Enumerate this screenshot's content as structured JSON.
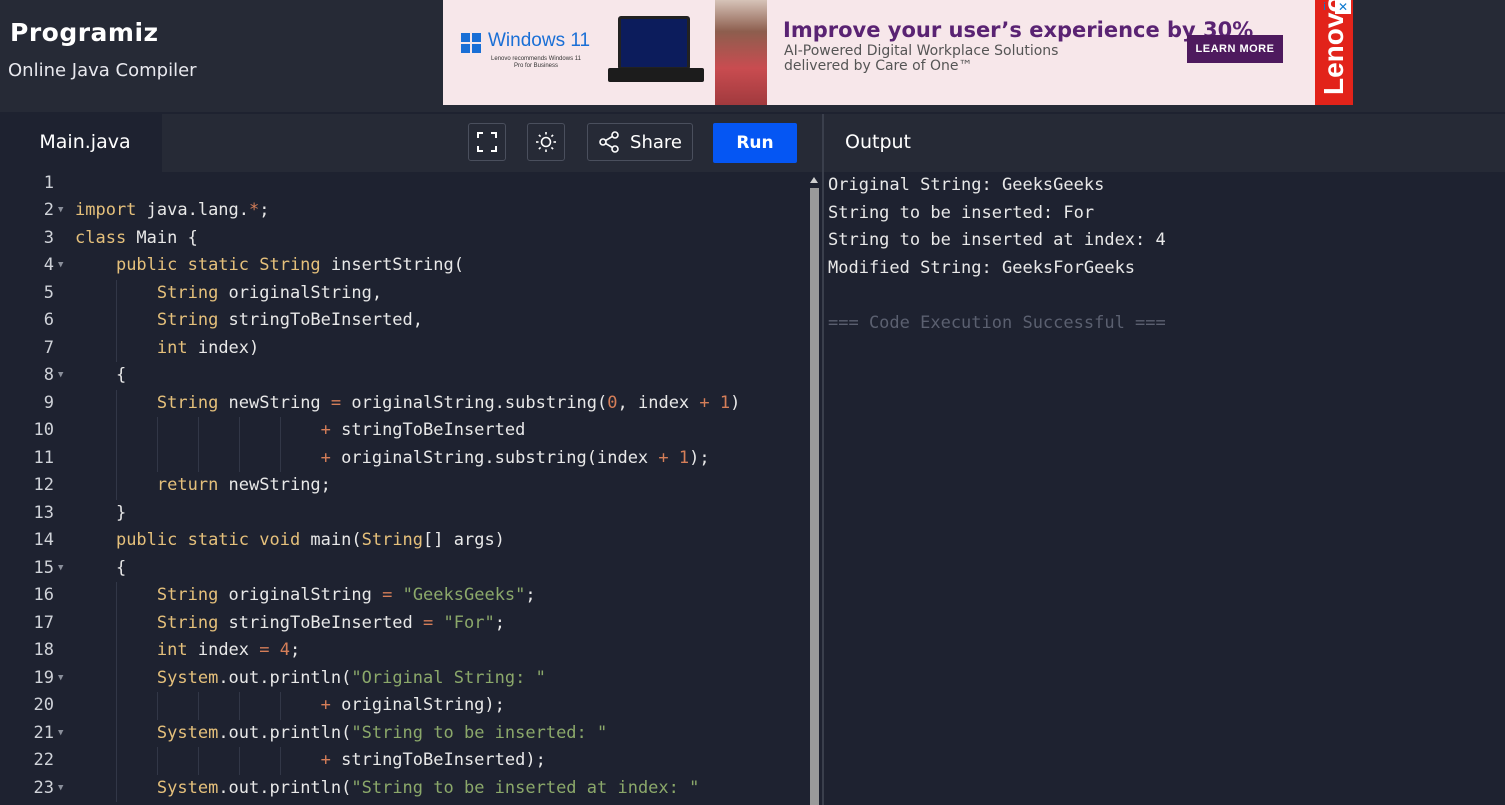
{
  "brand": {
    "logo": "Programiz",
    "subtitle": "Online Java Compiler"
  },
  "ad": {
    "windows_title": "Windows 11",
    "windows_sub": "Lenovo recommends Windows 11 Pro for Business",
    "headline": "Improve your user’s experience by 30%",
    "body_line1": "AI-Powered Digital Workplace Solutions",
    "body_line2": "delivered by Care of One™",
    "cta": "LEARN MORE",
    "brand": "Lenovo",
    "info": "i",
    "close": "✕",
    "brand_color": "#e2231a",
    "cta_color": "#4e1a5e"
  },
  "editor": {
    "tab": "Main.java",
    "share_label": "Share",
    "run_label": "Run",
    "run_color": "#0556f3",
    "line_numbers": [
      "1",
      "2",
      "3",
      "4",
      "5",
      "6",
      "7",
      "8",
      "9",
      "10",
      "11",
      "12",
      "13",
      "14",
      "15",
      "16",
      "17",
      "18",
      "19",
      "20",
      "21",
      "22",
      "23"
    ],
    "fold_rows": [
      "2",
      "4",
      "8",
      "15",
      "19",
      "21",
      "23"
    ],
    "lines": [
      [],
      [
        {
          "t": "import",
          "c": "kw"
        },
        {
          "t": " java.lang."
        },
        {
          "t": "*",
          "c": "op"
        },
        {
          "t": ";"
        }
      ],
      [
        {
          "t": "class",
          "c": "kw"
        },
        {
          "t": " Main {"
        }
      ],
      [
        {
          "t": "    "
        },
        {
          "t": "public static String",
          "c": "kw"
        },
        {
          "t": " insertString("
        }
      ],
      [
        {
          "t": "        "
        },
        {
          "t": "String",
          "c": "kw"
        },
        {
          "t": " originalString,"
        }
      ],
      [
        {
          "t": "        "
        },
        {
          "t": "String",
          "c": "kw"
        },
        {
          "t": " stringToBeInserted,"
        }
      ],
      [
        {
          "t": "        "
        },
        {
          "t": "int",
          "c": "kw"
        },
        {
          "t": " index)"
        }
      ],
      [
        {
          "t": "    {"
        }
      ],
      [
        {
          "t": "        "
        },
        {
          "t": "String",
          "c": "kw"
        },
        {
          "t": " newString "
        },
        {
          "t": "=",
          "c": "op"
        },
        {
          "t": " originalString.substring("
        },
        {
          "t": "0",
          "c": "nu"
        },
        {
          "t": ", index "
        },
        {
          "t": "+",
          "c": "op"
        },
        {
          "t": " "
        },
        {
          "t": "1",
          "c": "nu"
        },
        {
          "t": ")"
        }
      ],
      [
        {
          "t": "                        "
        },
        {
          "t": "+",
          "c": "op"
        },
        {
          "t": " stringToBeInserted"
        }
      ],
      [
        {
          "t": "                        "
        },
        {
          "t": "+",
          "c": "op"
        },
        {
          "t": " originalString.substring(index "
        },
        {
          "t": "+",
          "c": "op"
        },
        {
          "t": " "
        },
        {
          "t": "1",
          "c": "nu"
        },
        {
          "t": ");"
        }
      ],
      [
        {
          "t": "        "
        },
        {
          "t": "return",
          "c": "kw"
        },
        {
          "t": " newString;"
        }
      ],
      [
        {
          "t": "    }"
        }
      ],
      [
        {
          "t": "    "
        },
        {
          "t": "public static void",
          "c": "kw"
        },
        {
          "t": " main("
        },
        {
          "t": "String",
          "c": "kw"
        },
        {
          "t": "[] args)"
        }
      ],
      [
        {
          "t": "    {"
        }
      ],
      [
        {
          "t": "        "
        },
        {
          "t": "String",
          "c": "kw"
        },
        {
          "t": " originalString "
        },
        {
          "t": "=",
          "c": "op"
        },
        {
          "t": " "
        },
        {
          "t": "\"GeeksGeeks\"",
          "c": "st"
        },
        {
          "t": ";"
        }
      ],
      [
        {
          "t": "        "
        },
        {
          "t": "String",
          "c": "kw"
        },
        {
          "t": " stringToBeInserted "
        },
        {
          "t": "=",
          "c": "op"
        },
        {
          "t": " "
        },
        {
          "t": "\"For\"",
          "c": "st"
        },
        {
          "t": ";"
        }
      ],
      [
        {
          "t": "        "
        },
        {
          "t": "int",
          "c": "kw"
        },
        {
          "t": " index "
        },
        {
          "t": "=",
          "c": "op"
        },
        {
          "t": " "
        },
        {
          "t": "4",
          "c": "nu"
        },
        {
          "t": ";"
        }
      ],
      [
        {
          "t": "        "
        },
        {
          "t": "System",
          "c": "kw"
        },
        {
          "t": ".out.println("
        },
        {
          "t": "\"Original String: \"",
          "c": "st"
        }
      ],
      [
        {
          "t": "                        "
        },
        {
          "t": "+",
          "c": "op"
        },
        {
          "t": " originalString);"
        }
      ],
      [
        {
          "t": "        "
        },
        {
          "t": "System",
          "c": "kw"
        },
        {
          "t": ".out.println("
        },
        {
          "t": "\"String to be inserted: \"",
          "c": "st"
        }
      ],
      [
        {
          "t": "                        "
        },
        {
          "t": "+",
          "c": "op"
        },
        {
          "t": " stringToBeInserted);"
        }
      ],
      [
        {
          "t": "        "
        },
        {
          "t": "System",
          "c": "kw"
        },
        {
          "t": ".out.println("
        },
        {
          "t": "\"String to be inserted at index: \"",
          "c": "st"
        }
      ]
    ]
  },
  "output": {
    "title": "Output",
    "lines": [
      "Original String: GeeksGeeks",
      "String to be inserted: For",
      "String to be inserted at index: 4",
      "Modified String: GeeksForGeeks",
      "",
      "=== Code Execution Successful ==="
    ]
  }
}
